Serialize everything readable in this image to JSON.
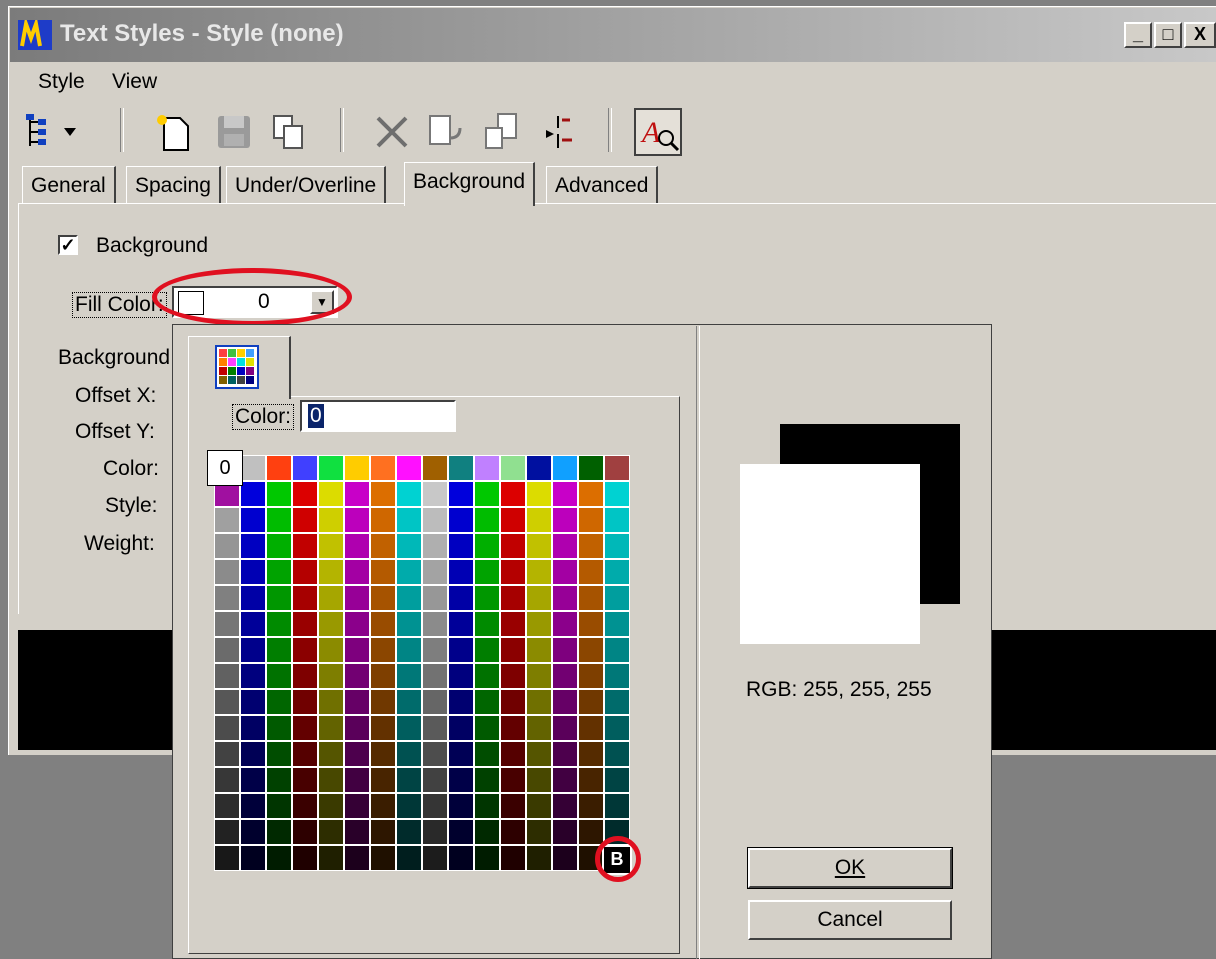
{
  "window": {
    "title": "Text Styles - Style (none)",
    "controls": [
      "_",
      "□",
      "X"
    ]
  },
  "menu": [
    {
      "label": "Style"
    },
    {
      "label": "View"
    }
  ],
  "toolbar": {
    "icons": [
      "tree-view-icon",
      "new-style-icon",
      "save-icon",
      "copy-icon",
      "delete-icon",
      "import-icon",
      "export-icon",
      "swap-icon",
      "preview-icon"
    ]
  },
  "tabs": [
    {
      "label": "General"
    },
    {
      "label": "Spacing"
    },
    {
      "label": "Under/Overline"
    },
    {
      "label": "Background"
    },
    {
      "label": "Advanced"
    }
  ],
  "active_tab": "Background",
  "background_panel": {
    "background_checkbox_label": "Background",
    "background_checked": true,
    "fill_color_label": "Fill Color:",
    "fill_color_value": "0",
    "fields": [
      {
        "label": "Background"
      },
      {
        "label": "Offset X:"
      },
      {
        "label": "Offset Y:"
      },
      {
        "label": "Color:"
      },
      {
        "label": "Style:"
      },
      {
        "label": "Weight:"
      }
    ]
  },
  "color_picker": {
    "color_label": "Color:",
    "color_value": "0",
    "selected_index_label": "0",
    "bg_cell_label": "B",
    "preview_rgb": "RGB: 255, 255, 255",
    "ok_label": "OK",
    "cancel_label": "Cancel",
    "highlight_color": "#e01020"
  }
}
